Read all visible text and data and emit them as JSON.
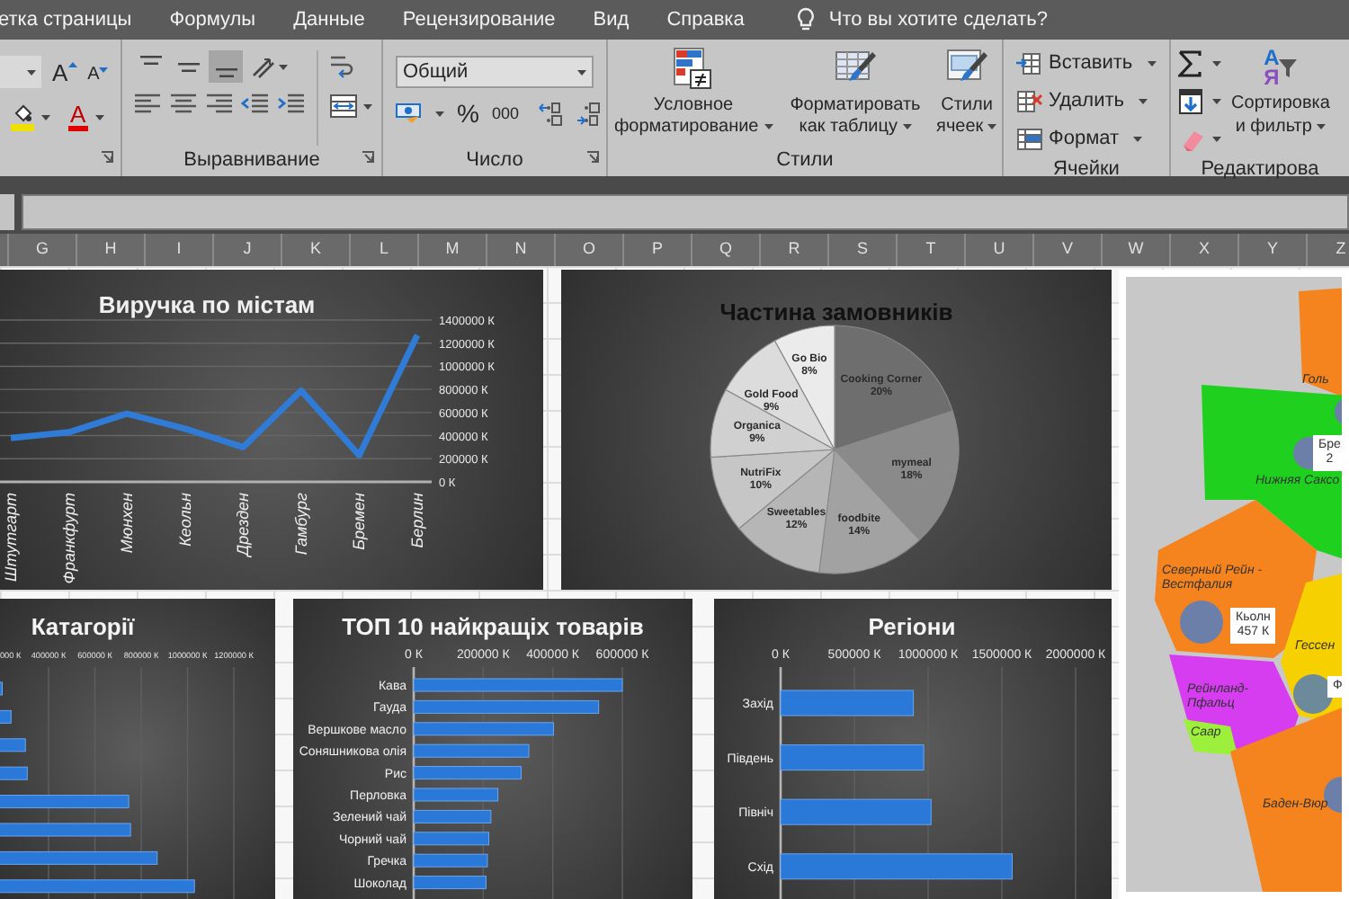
{
  "menu_tabs": [
    "етка страницы",
    "Формулы",
    "Данные",
    "Рецензирование",
    "Вид",
    "Справка"
  ],
  "tell_me": "Что вы хотите сделать?",
  "ribbon": {
    "font": {
      "grow": "A",
      "shrink": "A",
      "font_color": "A"
    },
    "alignment": {
      "label": "Выравнивание",
      "vertical": [
        {
          "kind": "top",
          "selected": false
        },
        {
          "kind": "middle",
          "selected": false
        },
        {
          "kind": "bottom",
          "selected": true
        }
      ]
    },
    "number": {
      "format": "Общий",
      "percent": "%",
      "thousands": "000",
      "label": "Число"
    },
    "styles": {
      "buttons": [
        {
          "label": "Условное форматирование",
          "kind": "conditional"
        },
        {
          "label": "Форматировать как таблицу",
          "kind": "table"
        },
        {
          "label": "Стили ячеек",
          "kind": "cell"
        }
      ],
      "label": "Стили"
    },
    "cells": {
      "buttons": [
        {
          "label": "Вставить",
          "kind": "insert"
        },
        {
          "label": "Удалить",
          "kind": "delete"
        },
        {
          "label": "Формат",
          "kind": "format"
        }
      ],
      "label": "Ячейки"
    },
    "editing": {
      "sort": {
        "label": "Сортировка и фильтр",
        "letters": [
          "А",
          "Я"
        ]
      },
      "label": "Редактирова"
    }
  },
  "columns": [
    "G",
    "H",
    "I",
    "J",
    "K",
    "L",
    "M",
    "N",
    "O",
    "P",
    "Q",
    "R",
    "S",
    "T",
    "U",
    "V",
    "W",
    "X",
    "Y",
    "Z"
  ],
  "charts": [
    {
      "chart_data": {
        "type": "line",
        "title": "Виручка по містам",
        "categories": [
          "Штутгарт",
          "Франкфурт",
          "Мюнхен",
          "Кеольн",
          "Дрезден",
          "Гамбург",
          "Бремен",
          "Берлин"
        ],
        "series": [
          {
            "color": "#2f7bd6",
            "values": [
              380000,
              430000,
              590000,
              460000,
              300000,
              790000,
              230000,
              1270000
            ]
          }
        ],
        "ylim": [
          0,
          1400000
        ],
        "grid": true,
        "yticks": [
          {
            "value": 1400000,
            "label": "1400000 К"
          },
          {
            "value": 1200000,
            "label": "1200000 К"
          },
          {
            "value": 1000000,
            "label": "1000000 К"
          },
          {
            "value": 800000,
            "label": "800000 К"
          },
          {
            "value": 600000,
            "label": "600000 К"
          },
          {
            "value": 400000,
            "label": "400000 К"
          },
          {
            "value": 200000,
            "label": "200000 К"
          },
          {
            "value": 0,
            "label": "0 К"
          }
        ]
      }
    },
    {
      "chart_data": {
        "type": "pie",
        "title": "Частина замовників",
        "categories": [
          "Cooking Corner",
          "mymeal",
          "foodbite",
          "Sweetables",
          "NutriFix",
          "Organica",
          "Gold Food",
          "Go Bio"
        ],
        "series": [
          {
            "values": [
              20,
              18,
              14,
              12,
              10,
              9,
              9,
              8
            ]
          }
        ],
        "value_labels": [
          "20%",
          "18%",
          "14%",
          "12%",
          "10%",
          "9%",
          "9%",
          "8%"
        ]
      }
    },
    {
      "cut_tick_label": "000 К",
      "chart_data": {
        "type": "bar",
        "orientation": "horizontal",
        "title": "Катагорії",
        "grid": true,
        "xlim": [
          0,
          1200000
        ],
        "series": [
          {
            "color": "#2a78d8",
            "values": [
              200000,
              238000,
              300000,
              308000,
              746000,
              754000,
              869000,
              1030000
            ]
          }
        ],
        "xticks": [
          {
            "value": 400000,
            "label": "400000 К"
          },
          {
            "value": 600000,
            "label": "600000 К"
          },
          {
            "value": 800000,
            "label": "800000 К"
          },
          {
            "value": 1000000,
            "label": "1000000 К"
          },
          {
            "value": 1200000,
            "label": "1200000 К"
          }
        ]
      }
    },
    {
      "chart_data": {
        "type": "bar",
        "orientation": "horizontal",
        "title": "ТОП 10 найкращіх товарів",
        "grid": true,
        "xlim": [
          0,
          600000
        ],
        "categories": [
          "Кава",
          "Гауда",
          "Вершкове масло",
          "Соняшникова олія",
          "Рис",
          "Перловка",
          "Зелений чай",
          "Чорний чай",
          "Гречка",
          "Шоколад"
        ],
        "series": [
          {
            "color": "#2a78d8",
            "values": [
              600000,
              532000,
              402000,
              331000,
              309000,
              242000,
              222000,
              216000,
              212000,
              208000
            ]
          }
        ],
        "xticks": [
          {
            "value": 0,
            "label": "0 К"
          },
          {
            "value": 200000,
            "label": "200000 К"
          },
          {
            "value": 400000,
            "label": "400000 К"
          },
          {
            "value": 600000,
            "label": "600000 К"
          }
        ]
      }
    },
    {
      "chart_data": {
        "type": "bar",
        "orientation": "horizontal",
        "title": "Регіони",
        "grid": true,
        "xlim": [
          0,
          2000000
        ],
        "categories": [
          "Захід",
          "Південь",
          "Північ",
          "Схід"
        ],
        "series": [
          {
            "color": "#2a78d8",
            "values": [
              900000,
              970000,
              1020000,
              1570000
            ]
          }
        ],
        "xticks": [
          {
            "value": 0,
            "label": "0 К"
          },
          {
            "value": 500000,
            "label": "500000 К"
          },
          {
            "value": 1000000,
            "label": "1000000 К"
          },
          {
            "value": 1500000,
            "label": "1500000 К"
          },
          {
            "value": 2000000,
            "label": "2000000 К"
          }
        ]
      }
    }
  ],
  "map": {
    "labels": [
      {
        "kind": "region",
        "lines": [
          "Голь"
        ]
      },
      {
        "kind": "callout",
        "lines": [
          "Бре",
          "2"
        ]
      },
      {
        "kind": "region",
        "lines": [
          "Нижняя Саксо"
        ]
      },
      {
        "kind": "region",
        "lines": [
          "Северный Рейн -",
          "Вестфалия"
        ]
      },
      {
        "kind": "callout",
        "lines": [
          "Кьолн",
          "457 К"
        ]
      },
      {
        "kind": "region",
        "lines": [
          "Гессен"
        ]
      },
      {
        "kind": "callout",
        "lines": [
          "Ф"
        ]
      },
      {
        "kind": "region",
        "lines": [
          "Рейнланд-",
          "Пфальц"
        ]
      },
      {
        "kind": "region",
        "lines": [
          "Саар"
        ]
      },
      {
        "kind": "region",
        "lines": [
          "Баден-Вюр"
        ]
      }
    ]
  }
}
